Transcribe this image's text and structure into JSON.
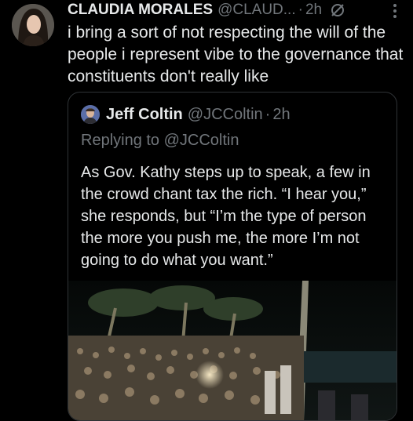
{
  "tweet": {
    "author_name": "CLAUDIA MORALES",
    "author_handle": "@CLAUD...",
    "separator": "·",
    "time": "2h",
    "text": "i bring a sort of not respecting the will of the people i represent vibe to the governance that constituents don't really like",
    "icons": [
      "avatar",
      "grok-icon",
      "more-icon"
    ]
  },
  "quoted": {
    "author_name": "Jeff Coltin",
    "author_handle": "@JCColtin",
    "separator": "·",
    "time": "2h",
    "reply_line": "Replying to @JCColtin",
    "text": "As Gov. Kathy steps up to speak, a few in the crowd chant tax the rich. “I hear you,” she responds, but “I’m the type of person the more you push me, the more I’m not going to do what you want.”",
    "media": "crowd-photo-at-night"
  },
  "colors": {
    "background": "#000000",
    "text": "#e7e9ea",
    "secondary": "#71767b",
    "border": "#2f3336"
  }
}
